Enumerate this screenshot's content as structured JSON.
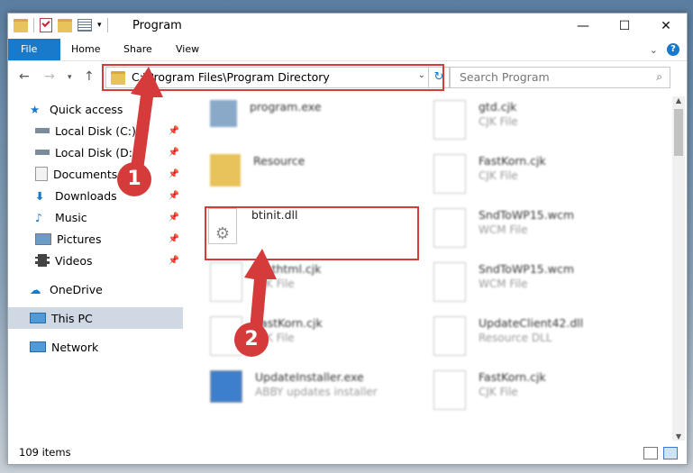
{
  "window": {
    "title": "Program"
  },
  "ribbon": {
    "tabs": [
      "File",
      "Home",
      "Share",
      "View"
    ]
  },
  "address": {
    "path": "C:\\Program Files\\Program Directory"
  },
  "search": {
    "placeholder": "Search Program"
  },
  "sidebar": {
    "items": [
      {
        "label": "Quick access",
        "icon": "star-icon"
      },
      {
        "label": "Local Disk (C:)",
        "icon": "drive-icon",
        "pinned": true
      },
      {
        "label": "Local Disk (D:)",
        "icon": "drive-icon",
        "pinned": true
      },
      {
        "label": "Documents",
        "icon": "documents-icon",
        "pinned": true
      },
      {
        "label": "Downloads",
        "icon": "download-icon",
        "pinned": true
      },
      {
        "label": "Music",
        "icon": "music-icon",
        "pinned": true
      },
      {
        "label": "Pictures",
        "icon": "pictures-icon",
        "pinned": true
      },
      {
        "label": "Videos",
        "icon": "videos-icon",
        "pinned": true
      },
      {
        "label": "OneDrive",
        "icon": "cloud-icon"
      },
      {
        "label": "This PC",
        "icon": "monitor-icon",
        "selected": true
      },
      {
        "label": "Network",
        "icon": "network-icon"
      }
    ]
  },
  "files": {
    "left": [
      {
        "name": "program.exe",
        "sub": ""
      },
      {
        "name": "Resource",
        "sub": ""
      },
      {
        "name": "btinit.dll",
        "sub": ""
      },
      {
        "name": "fasthtml.cjk",
        "sub": "CJK File"
      },
      {
        "name": "FastKorn.cjk",
        "sub": "CJK File"
      },
      {
        "name": "UpdateInstaller.exe",
        "sub": "ABBY updates installer"
      }
    ],
    "right": [
      {
        "name": "gtd.cjk",
        "sub": "CJK File"
      },
      {
        "name": "FastKorn.cjk",
        "sub": "CJK File"
      },
      {
        "name": "SndToWP15.wcm",
        "sub": "WCM File"
      },
      {
        "name": "SndToWP15.wcm",
        "sub": "WCM File"
      },
      {
        "name": "UpdateClient42.dll",
        "sub": "Resource DLL"
      },
      {
        "name": "FastKorn.cjk",
        "sub": "CJK File"
      }
    ]
  },
  "status": {
    "count": "109 items"
  },
  "markers": {
    "one": "1",
    "two": "2"
  },
  "colors": {
    "accent": "#1979ca",
    "highlight": "#d63b3b"
  }
}
